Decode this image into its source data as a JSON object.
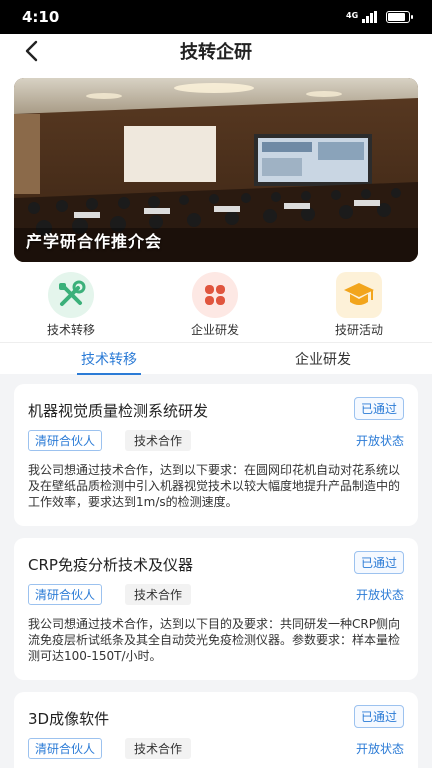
{
  "status_bar": {
    "time": "4:10",
    "network": "4G"
  },
  "header": {
    "title": "技转企研",
    "back_icon": "chevron-left-icon"
  },
  "hero": {
    "caption": "产学研合作推介会"
  },
  "quick_nav": [
    {
      "label": "技术转移",
      "icon": "tools-icon",
      "color": "#3bb07a"
    },
    {
      "label": "企业研发",
      "icon": "clover-icon",
      "color": "#e0553e"
    },
    {
      "label": "技研活动",
      "icon": "graduation-cap-icon",
      "color": "#f2a51c"
    }
  ],
  "tabs": [
    {
      "label": "技术转移",
      "active": true
    },
    {
      "label": "企业研发",
      "active": false
    }
  ],
  "accent_color": "#2b7bd6",
  "cards": [
    {
      "title": "机器视觉质量检测系统研发",
      "status": "已通过",
      "tag_partner": "清研合伙人",
      "tag_type": "技术合作",
      "open_status": "开放状态",
      "description": "我公司想通过技术合作，达到以下要求：在圆网印花机自动对花系统以及在壁纸品质检测中引入机器视觉技术以较大幅度地提升产品制造中的工作效率，要求达到1m/s的检测速度。"
    },
    {
      "title": "CRP免疫分析技术及仪器",
      "status": "已通过",
      "tag_partner": "清研合伙人",
      "tag_type": "技术合作",
      "open_status": "开放状态",
      "description": "我公司想通过技术合作，达到以下目的及要求：共同研发一种CRP侧向流免疫层析试纸条及其全自动荧光免疫检测仪器。参数要求：样本量检测可达100-150T/小时。"
    },
    {
      "title": "3D成像软件",
      "status": "已通过",
      "tag_partner": "清研合伙人",
      "tag_type": "技术合作",
      "open_status": "开放状态",
      "description": ""
    }
  ]
}
